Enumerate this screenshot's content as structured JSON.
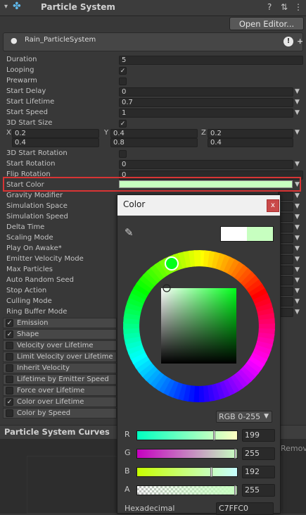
{
  "header": {
    "title": "Particle System",
    "help_icon": "help-icon",
    "settings_icon": "sliders-icon",
    "menu_icon": "kebab-menu-icon"
  },
  "toolbar": {
    "open_editor": "Open Editor..."
  },
  "particle_system": {
    "name": "Rain_ParticleSystem"
  },
  "properties": [
    {
      "label": "Duration",
      "value": "5",
      "type": "field"
    },
    {
      "label": "Looping",
      "value": "✓",
      "type": "check"
    },
    {
      "label": "Prewarm",
      "value": "",
      "type": "check"
    },
    {
      "label": "Start Delay",
      "value": "0",
      "type": "dropdown"
    },
    {
      "label": "Start Lifetime",
      "value": "0.7",
      "type": "dropdown"
    },
    {
      "label": "Start Speed",
      "value": "1",
      "type": "dropdown"
    },
    {
      "label": "3D Start Size",
      "value": "✓",
      "type": "check"
    }
  ],
  "start_size": {
    "x_label": "X",
    "y_label": "Y",
    "z_label": "Z",
    "row1": [
      "0.2",
      "0.4",
      "0.2"
    ],
    "row2": [
      "0.4",
      "0.8",
      "0.4"
    ]
  },
  "properties2": [
    {
      "label": "3D Start Rotation",
      "value": "",
      "type": "check"
    },
    {
      "label": "Start Rotation",
      "value": "0",
      "type": "dropdown"
    },
    {
      "label": "Flip Rotation",
      "value": "0",
      "type": "field"
    },
    {
      "label": "Start Color",
      "value": "",
      "type": "color"
    }
  ],
  "properties3": [
    {
      "label": "Gravity Modifier",
      "value": ""
    },
    {
      "label": "Simulation Space",
      "value": ""
    },
    {
      "label": "Simulation Speed",
      "value": ""
    },
    {
      "label": "Delta Time",
      "value": ""
    },
    {
      "label": "Scaling Mode",
      "value": ""
    },
    {
      "label": "Play On Awake*",
      "value": ""
    },
    {
      "label": "Emitter Velocity Mode",
      "value": ""
    },
    {
      "label": "Max Particles",
      "value": ""
    },
    {
      "label": "Auto Random Seed",
      "value": ""
    },
    {
      "label": "Stop Action",
      "value": ""
    },
    {
      "label": "Culling Mode",
      "value": ""
    },
    {
      "label": "Ring Buffer Mode",
      "value": ""
    }
  ],
  "modules": [
    {
      "label": "Emission",
      "checked": "✓"
    },
    {
      "label": "Shape",
      "checked": "✓"
    },
    {
      "label": "Velocity over Lifetime",
      "checked": ""
    },
    {
      "label": "Limit Velocity over Lifetime",
      "checked": ""
    },
    {
      "label": "Inherit Velocity",
      "checked": ""
    },
    {
      "label": "Lifetime by Emitter Speed",
      "checked": ""
    },
    {
      "label": "Force over Lifetime",
      "checked": ""
    },
    {
      "label": "Color over Lifetime",
      "checked": "✓"
    },
    {
      "label": "Color by Speed",
      "checked": ""
    }
  ],
  "curves": {
    "title": "Particle System Curves",
    "remove": "Remove"
  },
  "color_picker": {
    "title": "Color",
    "close": "x",
    "mode": "RGB 0-255",
    "channels": [
      {
        "label": "R",
        "value": "199"
      },
      {
        "label": "G",
        "value": "255"
      },
      {
        "label": "B",
        "value": "192"
      },
      {
        "label": "A",
        "value": "255"
      }
    ],
    "hex_label": "Hexadecimal",
    "hex_value": "C7FFC0",
    "current_color": "#c7ffc0",
    "previous_color": "#ffffff"
  },
  "colors": {
    "selection_outline": "#d83434",
    "start_color": "#c7ffc0"
  }
}
